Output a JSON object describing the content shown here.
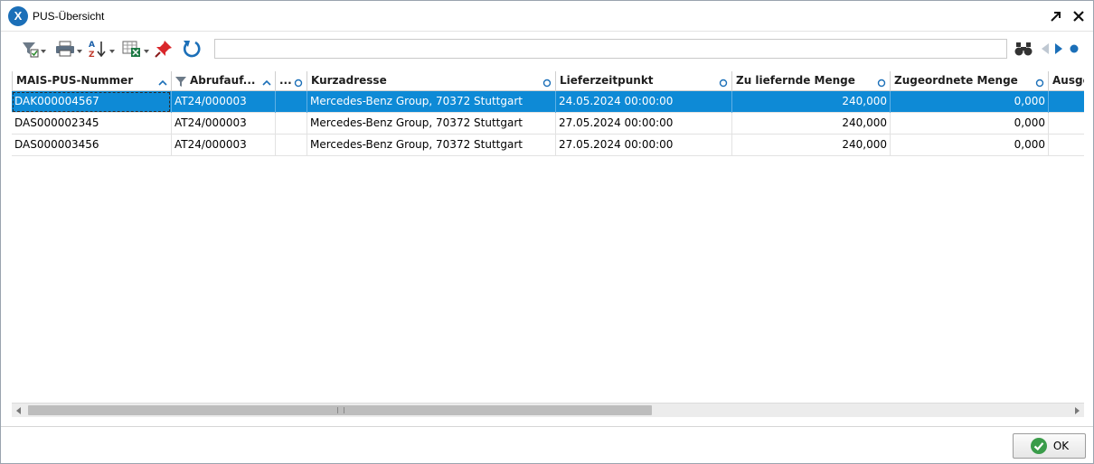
{
  "window": {
    "title": "PUS-Übersicht",
    "logo_letter": "X",
    "icons": {
      "logo": "x-logo-icon",
      "popout": "arrow-up-right-icon",
      "close": "close-icon"
    }
  },
  "toolbar": {
    "filter_value": "",
    "icons": [
      "filter-check-icon",
      "printer-icon",
      "sort-az-icon",
      "excel-export-icon",
      "pin-icon",
      "refresh-icon",
      "binoculars-icon",
      "nav-prev-icon",
      "nav-next-icon",
      "nav-dot-icon"
    ]
  },
  "grid": {
    "columns": [
      {
        "label": "MAIS-PUS-Nummer",
        "icon": "sort-up-icon"
      },
      {
        "label": "Abrufauf...",
        "icon": "sort-up-icon",
        "filter_icon": "filter-icon"
      },
      {
        "label": "...",
        "icon": "circle-icon"
      },
      {
        "label": "Kurzadresse",
        "icon": "circle-icon"
      },
      {
        "label": "Lieferzeitpunkt",
        "icon": "circle-icon"
      },
      {
        "label": "Zu liefernde Menge",
        "icon": "circle-icon"
      },
      {
        "label": "Zugeordnete Menge",
        "icon": "circle-icon"
      },
      {
        "label": "Ausge"
      }
    ],
    "rows": [
      {
        "nummer": "DAK000004567",
        "abruf": "AT24/000003",
        "extra": "",
        "adresse": "Mercedes-Benz Group, 70372 Stuttgart",
        "liefer": "24.05.2024 00:00:00",
        "zu_liefern": "240,000",
        "zugeordnet": "0,000",
        "ausge": ""
      },
      {
        "nummer": "DAS000002345",
        "abruf": "AT24/000003",
        "extra": "",
        "adresse": "Mercedes-Benz Group, 70372 Stuttgart",
        "liefer": "27.05.2024 00:00:00",
        "zu_liefern": "240,000",
        "zugeordnet": "0,000",
        "ausge": ""
      },
      {
        "nummer": "DAS000003456",
        "abruf": "AT24/000003",
        "extra": "",
        "adresse": "Mercedes-Benz Group, 70372 Stuttgart",
        "liefer": "27.05.2024 00:00:00",
        "zu_liefern": "240,000",
        "zugeordnet": "0,000",
        "ausge": ""
      }
    ],
    "selected_row": 0,
    "colors": {
      "selection": "#0e8ad6",
      "accent": "#1b6fb8"
    }
  },
  "footer": {
    "ok_label": "OK",
    "ok_icon": "check-circle-icon"
  }
}
